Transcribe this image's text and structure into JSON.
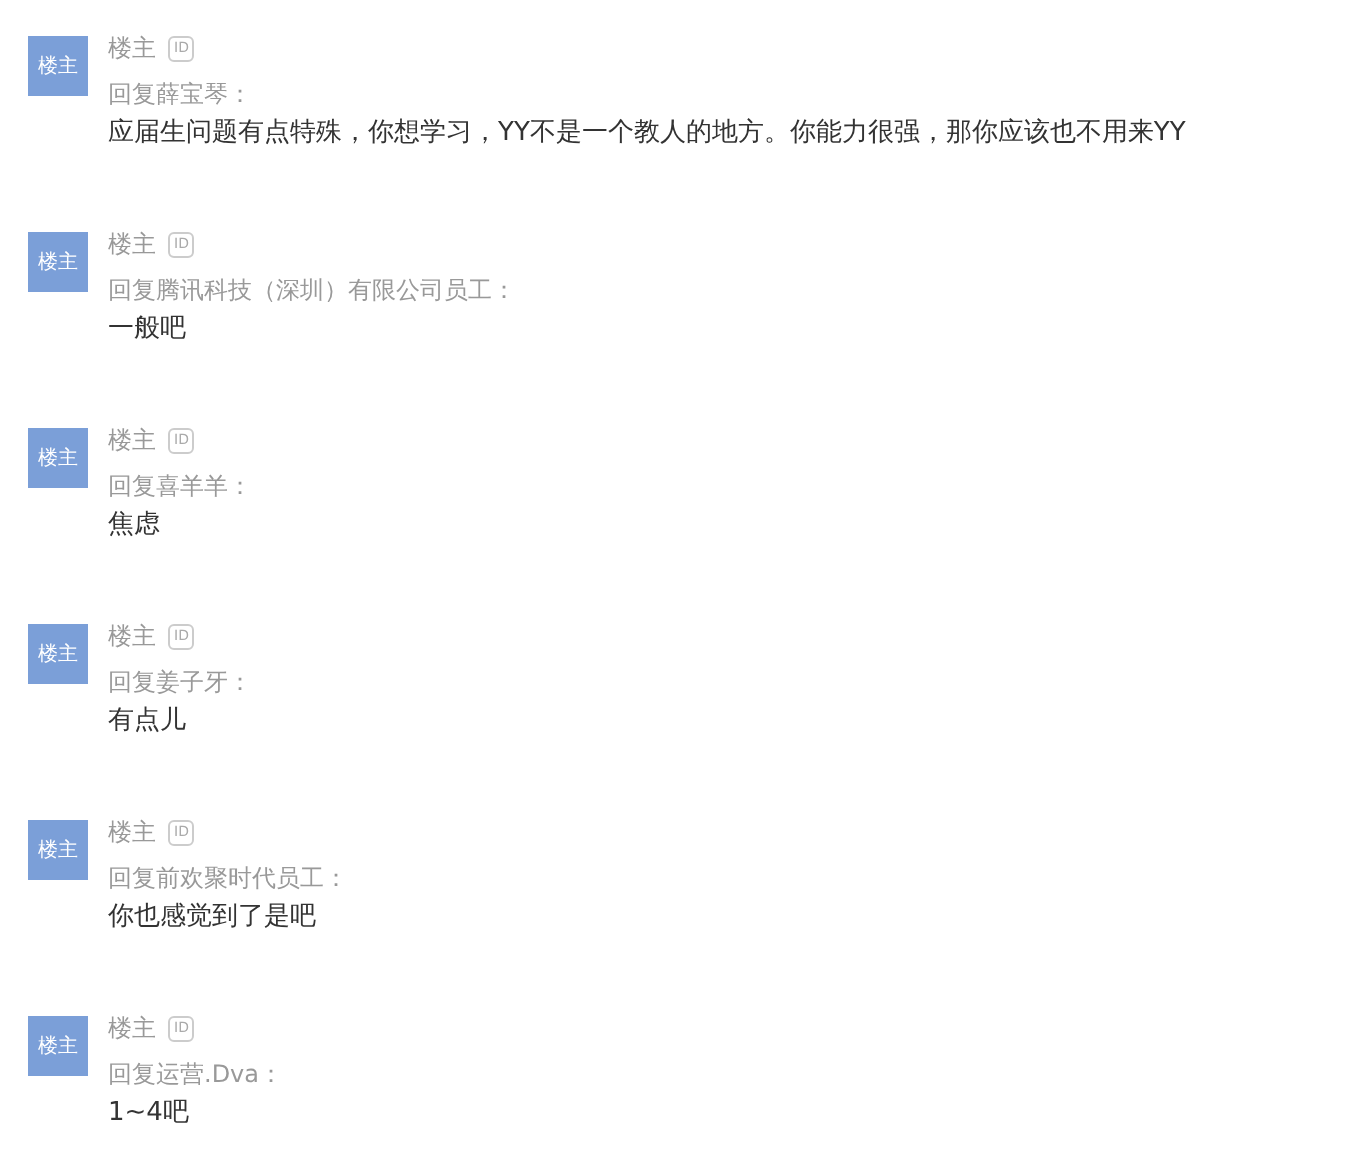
{
  "replies": [
    {
      "avatar": "楼主",
      "author": "楼主",
      "badge": "ID",
      "reply_to": "回复薛宝琴：",
      "text": "应届生问题有点特殊，你想学习，YY不是一个教人的地方。你能力很强，那你应该也不用来YY"
    },
    {
      "avatar": "楼主",
      "author": "楼主",
      "badge": "ID",
      "reply_to": "回复腾讯科技（深圳）有限公司员工：",
      "text": "一般吧"
    },
    {
      "avatar": "楼主",
      "author": "楼主",
      "badge": "ID",
      "reply_to": "回复喜羊羊：",
      "text": "焦虑"
    },
    {
      "avatar": "楼主",
      "author": "楼主",
      "badge": "ID",
      "reply_to": "回复姜子牙：",
      "text": "有点儿"
    },
    {
      "avatar": "楼主",
      "author": "楼主",
      "badge": "ID",
      "reply_to": "回复前欢聚时代员工：",
      "text": "你也感觉到了是吧"
    },
    {
      "avatar": "楼主",
      "author": "楼主",
      "badge": "ID",
      "reply_to": "回复运营.Dva：",
      "text": "1~4吧"
    }
  ]
}
